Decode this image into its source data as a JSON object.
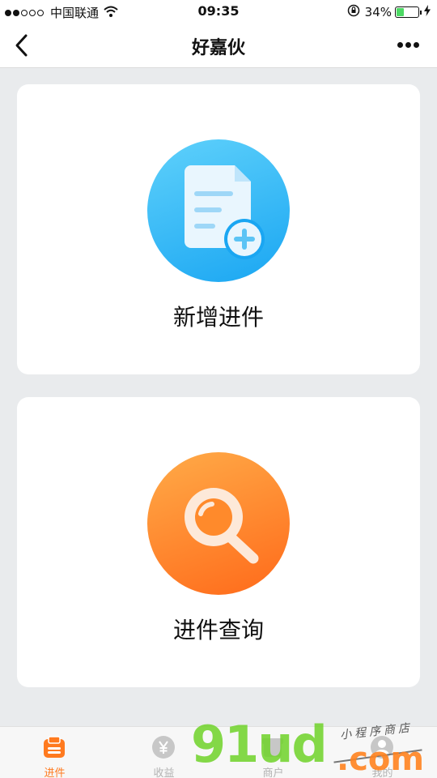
{
  "status_bar": {
    "carrier": "中国联通",
    "time": "09:35",
    "battery": "34%"
  },
  "nav": {
    "title": "好嘉伙"
  },
  "cards": [
    {
      "label": "新增进件",
      "icon": "document-add-icon",
      "color": "#1aa6f2"
    },
    {
      "label": "进件查询",
      "icon": "search-icon",
      "color": "#ff6a1a"
    }
  ],
  "tabs": [
    {
      "label": "进件",
      "icon": "clipboard-icon",
      "active": true
    },
    {
      "label": "收益",
      "icon": "yen-icon",
      "active": false
    },
    {
      "label": "商户",
      "icon": "store-icon",
      "active": false
    },
    {
      "label": "我的",
      "icon": "user-icon",
      "active": false
    }
  ],
  "watermark": {
    "main": "91ud",
    "tag": "小程序商店",
    "suffix": ".com"
  },
  "colors": {
    "accent": "#ff7a1f",
    "tab_inactive": "#b3b3b3",
    "background": "#e9ebed"
  }
}
